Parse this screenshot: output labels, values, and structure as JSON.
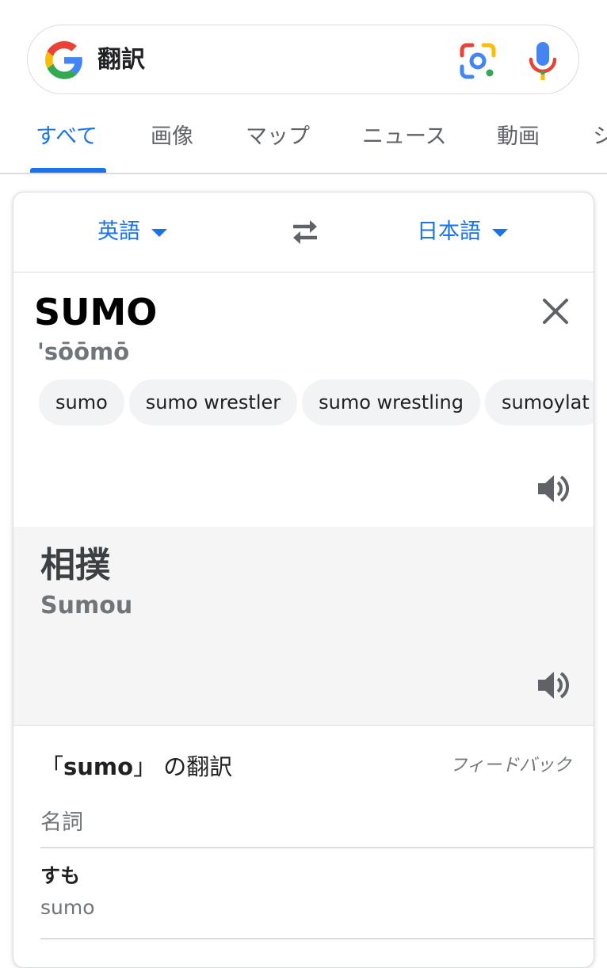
{
  "search": {
    "query": "翻訳"
  },
  "tabs": [
    "すべて",
    "画像",
    "マップ",
    "ニュース",
    "動画",
    "シ"
  ],
  "translator": {
    "source_lang": "英語",
    "target_lang": "日本語",
    "source_text": "SUMO",
    "pronunciation": "'sōōmō",
    "suggestions": [
      "sumo",
      "sumo wrestler",
      "sumo wrestling",
      "sumoylat"
    ],
    "translation": "相撲",
    "romanization": "Sumou"
  },
  "dictionary": {
    "title_prefix": "「",
    "title_word": "sumo",
    "title_suffix": "」 の翻訳",
    "feedback_label": "フィードバック",
    "part_of_speech": "名詞",
    "entries": [
      {
        "word": "すも",
        "translation": "sumo"
      }
    ]
  },
  "colors": {
    "accent": "#1a73e8",
    "text": "#202124",
    "muted": "#70757a",
    "panel": "#f5f5f5"
  }
}
